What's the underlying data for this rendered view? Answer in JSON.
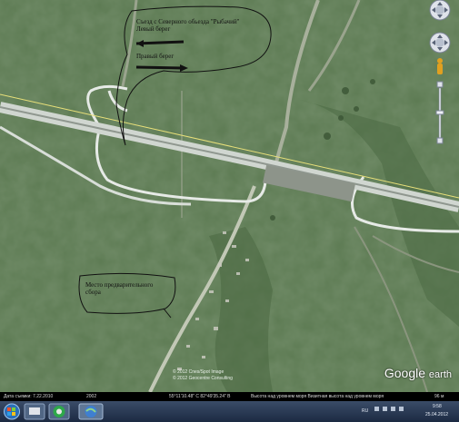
{
  "map": {
    "title_callout": {
      "line1": "Съезд с Северного обьезда \"Рыбачий\"",
      "line2": "Левый берег",
      "line3": "Правый берег"
    },
    "gathering_callout": {
      "line1": "Место предварительного",
      "line2": "сбора"
    },
    "copyright": {
      "line1": "© 2012 Cnes/Spot Image",
      "line2": "© 2012 Geocentre Consulting"
    }
  },
  "logo": {
    "brand": "Google",
    "product": "earth"
  },
  "statusbar": {
    "date": "Дата съемки: 7.22.2010",
    "year": "2002",
    "coords": "55°11'10.48\" С 82°49'35.24\" В",
    "elevation": "Высота над уровнем моря Визитная высота над уровнем моря",
    "scale": "96 м"
  },
  "taskbar": {
    "lang": "RU",
    "time": "9:58",
    "date": "25.04.2012"
  },
  "colors": {
    "terrain": "#5c7a52",
    "road": "#e6eae6",
    "highway_line": "#e8e07a",
    "arrow": "#111111"
  },
  "icons": [
    "compass-icon",
    "look-joystick-icon",
    "move-joystick-icon",
    "pegman-icon",
    "zoom-slider-icon",
    "windows-start-icon",
    "chrome-icon",
    "google-earth-icon"
  ]
}
